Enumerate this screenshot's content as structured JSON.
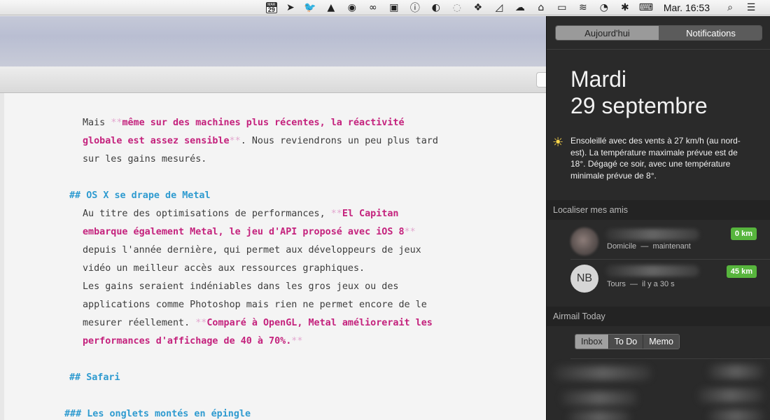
{
  "menubar": {
    "calendar_month": "MAR",
    "calendar_day": "29",
    "clock": "Mar. 16:53",
    "icons": [
      "calendar-icon",
      "location-arrow-icon",
      "twitter-icon",
      "evernote-icon",
      "alfred-icon",
      "creative-cloud-icon",
      "lastpass-icon",
      "one-password-icon",
      "toggle-icon",
      "blurred-app-icon",
      "dropbox-icon",
      "triangle-icon",
      "hazel-icon",
      "backup-icon",
      "airplay-icon",
      "wifi-icon",
      "time-machine-icon",
      "bluetooth-icon",
      "keyboard-icon",
      "clock",
      "spotlight-icon",
      "list-icon"
    ]
  },
  "editor": {
    "lines": [
      {
        "parts": [
          [
            "t",
            "Mais "
          ],
          [
            "m",
            "**"
          ],
          [
            "b",
            "même sur des machines plus récentes, la réactivité"
          ]
        ]
      },
      {
        "parts": [
          [
            "b",
            "globale est assez sensible"
          ],
          [
            "m",
            "**"
          ],
          [
            "t",
            ". Nous reviendrons un peu plus tard"
          ]
        ]
      },
      {
        "parts": [
          [
            "t",
            "sur les gains mesurés."
          ]
        ]
      },
      {
        "parts": []
      },
      {
        "heading": true,
        "parts": [
          [
            "h",
            "## "
          ],
          [
            "h",
            "OS X se drape de Metal"
          ]
        ]
      },
      {
        "parts": [
          [
            "t",
            "Au titre des optimisations de performances, "
          ],
          [
            "m",
            "**"
          ],
          [
            "b",
            "El Capitan"
          ]
        ]
      },
      {
        "parts": [
          [
            "b",
            "embarque également Metal, le jeu d'API proposé avec iOS 8"
          ],
          [
            "m",
            "**"
          ]
        ]
      },
      {
        "parts": [
          [
            "t",
            "depuis l'année dernière, qui permet aux développeurs de jeux"
          ]
        ]
      },
      {
        "parts": [
          [
            "t",
            "vidéo un meilleur accès aux ressources graphiques."
          ]
        ]
      },
      {
        "parts": [
          [
            "t",
            "Les gains seraient indéniables dans les gros jeux ou des"
          ]
        ]
      },
      {
        "parts": [
          [
            "t",
            "applications comme Photoshop mais rien ne permet encore de le"
          ]
        ]
      },
      {
        "parts": [
          [
            "t",
            "mesurer réellement. "
          ],
          [
            "m",
            "**"
          ],
          [
            "b",
            "Comparé à OpenGL, Metal améliorerait les"
          ]
        ]
      },
      {
        "parts": [
          [
            "b",
            "performances d'affichage de 40 à 70%."
          ],
          [
            "m",
            "**"
          ]
        ]
      },
      {
        "parts": []
      },
      {
        "heading": true,
        "parts": [
          [
            "h",
            "## "
          ],
          [
            "h",
            "Safari"
          ]
        ]
      },
      {
        "parts": []
      },
      {
        "heading": true,
        "h3": true,
        "parts": [
          [
            "h",
            "### "
          ],
          [
            "h",
            "Les onglets montés en épingle"
          ]
        ]
      }
    ]
  },
  "nc": {
    "tab_today": "Aujourd'hui",
    "tab_notifications": "Notifications",
    "day_name": "Mardi",
    "date": "29 septembre",
    "weather": "Ensoleillé avec des vents à 27 km/h (au nord-est). La température maximale prévue est de 18°. Dégagé ce soir, avec une température minimale prévue de 8°.",
    "find_friends_title": "Localiser mes amis",
    "friends": [
      {
        "initials": "",
        "location": "Domicile",
        "time": "maintenant",
        "distance": "0 km"
      },
      {
        "initials": "NB",
        "location": "Tours",
        "time": "il y a 30 s",
        "distance": "45 km"
      }
    ],
    "separator": "—",
    "airmail_title": "Airmail Today",
    "airmail_tabs": [
      "Inbox",
      "To Do",
      "Memo"
    ]
  }
}
